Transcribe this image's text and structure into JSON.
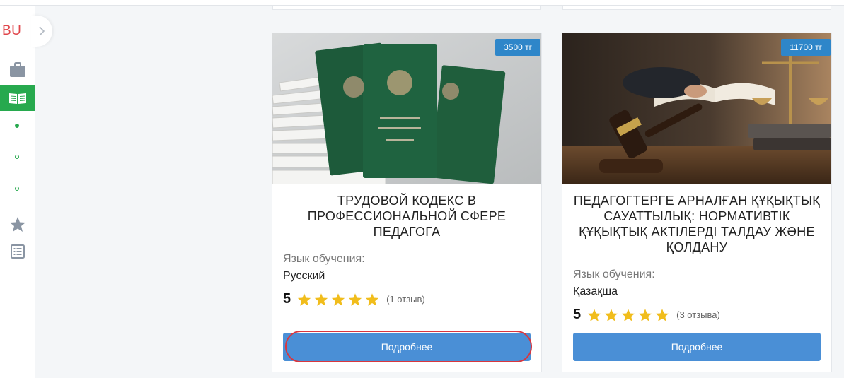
{
  "sidebar": {
    "logo": "BU",
    "items": [
      {
        "name": "briefcase"
      },
      {
        "name": "courses",
        "active": true
      },
      {
        "name": "starred"
      },
      {
        "name": "list"
      }
    ]
  },
  "courses": [
    {
      "price": "3500 тг",
      "title": "ТРУДОВОЙ КОДЕКС В ПРОФЕССИОНАЛЬНОЙ СФЕРЕ ПЕДАГОГА",
      "language_label": "Язык обучения:",
      "language": "Русский",
      "rating": "5",
      "stars": 5,
      "reviews": "(1 отзыв)",
      "button": "Подробнее"
    },
    {
      "price": "11700 тг",
      "title": "ПЕДАГОГТЕРГЕ АРНАЛҒАН ҚҰҚЫҚТЫҚ САУАТТЫЛЫҚ: НОРМАТИВТІК ҚҰҚЫҚТЫҚ АКТІЛЕРДІ ТАЛДАУ ЖӘНЕ ҚОЛДАНУ",
      "language_label": "Язык обучения:",
      "language": "Қазақша",
      "rating": "5",
      "stars": 5,
      "reviews": "(3 отзыва)",
      "button": "Подробнее"
    }
  ],
  "colors": {
    "accent_green": "#27a94e",
    "button_blue": "#4a8fd6",
    "price_blue": "#2e86c9",
    "star_gold": "#f1bd1c",
    "highlight_red": "#d9363e"
  }
}
